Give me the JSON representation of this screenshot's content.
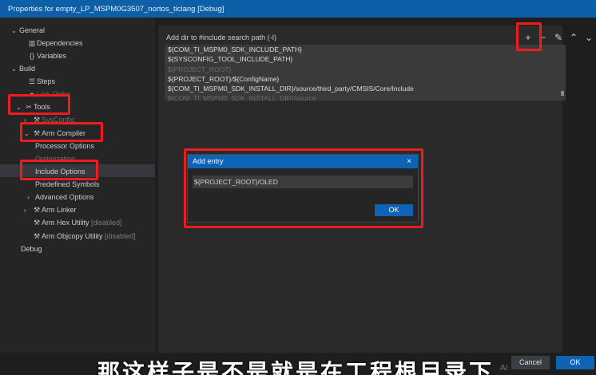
{
  "window": {
    "title": "Properties for empty_LP_MSPM0G3507_nortos_ticlang [Debug]"
  },
  "sidebar": {
    "items": [
      {
        "label": "General",
        "chevron": "⌄",
        "icon": ""
      },
      {
        "label": "Dependencies",
        "chevron": "",
        "icon": "deps-icon"
      },
      {
        "label": "Variables",
        "chevron": "",
        "icon": "braces-icon"
      },
      {
        "label": "Build",
        "chevron": "⌄",
        "icon": ""
      },
      {
        "label": "Steps",
        "chevron": "",
        "icon": "list-icon"
      },
      {
        "label": "Link Order",
        "chevron": "",
        "icon": "link-icon"
      },
      {
        "label": "Tools",
        "chevron": "⌄",
        "icon": "tools-icon"
      },
      {
        "label": "SysConfig",
        "chevron": "›",
        "icon": "wrench-icon"
      },
      {
        "label": "Arm Compiler",
        "chevron": "⌄",
        "icon": "wrench-icon"
      },
      {
        "label": "Processor Options",
        "chevron": "",
        "icon": ""
      },
      {
        "label": "Optimization",
        "chevron": "",
        "icon": ""
      },
      {
        "label": "Include Options",
        "chevron": "",
        "icon": ""
      },
      {
        "label": "Predefined Symbols",
        "chevron": "",
        "icon": ""
      },
      {
        "label": "Advanced Options",
        "chevron": "›",
        "icon": ""
      },
      {
        "label": "Arm Linker",
        "chevron": "›",
        "icon": "wrench-icon"
      },
      {
        "label": "Arm Hex Utility",
        "chevron": "",
        "icon": "wrench-icon",
        "suffix": "[disabled]"
      },
      {
        "label": "Arm Objcopy Utility",
        "chevron": "",
        "icon": "wrench-icon",
        "suffix": "[disabled]"
      },
      {
        "label": "Debug",
        "chevron": "",
        "icon": ""
      }
    ]
  },
  "main": {
    "section_label": "Add dir to #include search path (-I)",
    "toolbar": {
      "add": "+",
      "remove": "−",
      "edit": "✎",
      "up": "⌃",
      "down": "⌄"
    },
    "paths": [
      "${COM_TI_MSPM0_SDK_INCLUDE_PATH}",
      "${SYSCONFIG_TOOL_INCLUDE_PATH}",
      "${PROJECT_ROOT}",
      "${PROJECT_ROOT}/${ConfigName}",
      "${COM_TI_MSPM0_SDK_INSTALL_DIR}/source/third_party/CMSIS/Core/Include",
      "${COM_TI_MSPM0_SDK_INSTALL_DIR}/source"
    ]
  },
  "dialog": {
    "title": "Add entry",
    "close": "×",
    "input_value": "${PROJECT_ROOT}/OLED",
    "ok_label": "OK"
  },
  "footer": {
    "cancel_label": "Cancel",
    "ok_label": "OK"
  },
  "subtitle": "那这样子是不是就是在工程根目录下",
  "watermark": "AI",
  "colors": {
    "accent": "#0e63b4",
    "highlight": "#ee1c1c"
  }
}
